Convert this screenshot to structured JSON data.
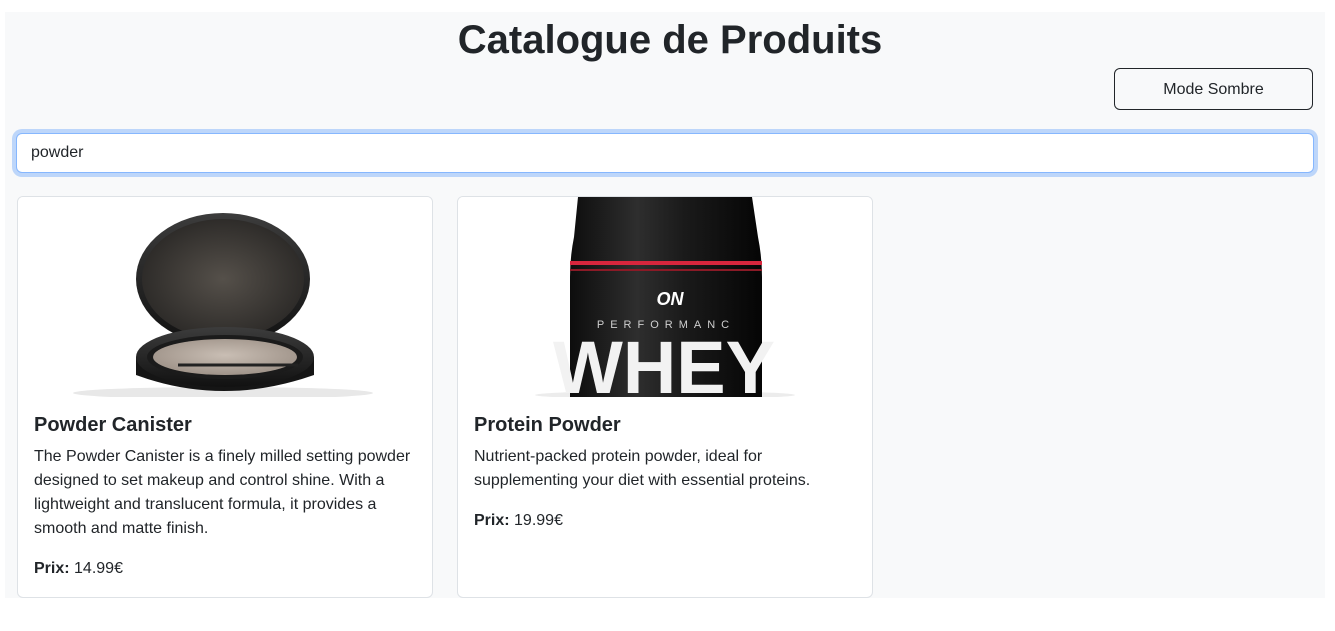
{
  "header": {
    "title": "Catalogue de Produits",
    "mode_button_label": "Mode Sombre"
  },
  "search": {
    "value": "powder"
  },
  "products": [
    {
      "name": "Powder Canister",
      "description": "The Powder Canister is a finely milled setting powder designed to set makeup and control shine. With a lightweight and translucent formula, it provides a smooth and matte finish.",
      "price_label": "Prix:",
      "price": "14.99€",
      "image_icon": "powder-compact-image"
    },
    {
      "name": "Protein Powder",
      "description": "Nutrient-packed protein powder, ideal for supplementing your diet with essential proteins.",
      "price_label": "Prix:",
      "price": "19.99€",
      "image_icon": "protein-tub-image",
      "image_text": {
        "brand": "ON",
        "line": "PERFORMANC",
        "product": "WHEY"
      }
    }
  ],
  "colors": {
    "background": "#f8f9fa",
    "focus_border": "#86b7fe",
    "accent_red": "#d7263d"
  }
}
